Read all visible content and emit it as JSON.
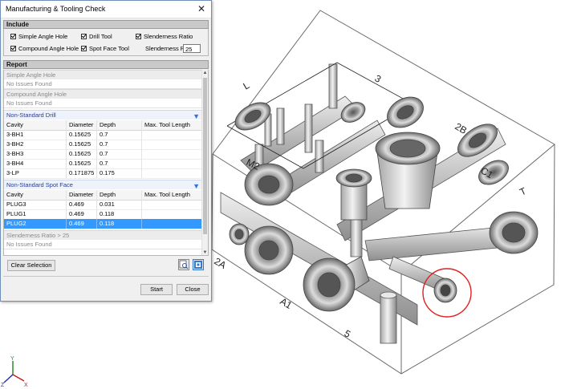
{
  "dialog": {
    "title": "Manufacturing & Tooling Check",
    "close_glyph": "✕"
  },
  "include": {
    "header": "Include",
    "options": {
      "simple_angle_hole": "Simple Angle Hole",
      "drill_tool": "Drill Tool",
      "slenderness_ratio": "Slenderness Ratio",
      "compound_angle_hole": "Compound Angle Hole",
      "spot_face_tool": "Spot Face Tool"
    },
    "slenderness_ratio_label": "Slenderness Ratio",
    "slenderness_ratio_value": "25"
  },
  "report": {
    "header": "Report",
    "simple_angle_hole": {
      "title": "Simple Angle Hole",
      "status": "No Issues Found"
    },
    "compound_angle_hole": {
      "title": "Compound Angle Hole",
      "status": "No Issues Found"
    },
    "non_standard_drill": {
      "title": "Non-Standard Drill",
      "columns": [
        "Cavity",
        "Diameter",
        "Depth",
        "Max. Tool Length"
      ],
      "rows": [
        [
          "3-BH1",
          "0.15625",
          "0.7",
          ""
        ],
        [
          "3-BH2",
          "0.15625",
          "0.7",
          ""
        ],
        [
          "3-BH3",
          "0.15625",
          "0.7",
          ""
        ],
        [
          "3-BH4",
          "0.15625",
          "0.7",
          ""
        ],
        [
          "3-LP",
          "0.171875",
          "0.175",
          ""
        ]
      ]
    },
    "non_standard_spot_face": {
      "title": "Non-Standard Spot Face",
      "columns": [
        "Cavity",
        "Diameter",
        "Depth",
        "Max. Tool Length"
      ],
      "rows": [
        [
          "PLUG3",
          "0.469",
          "0.031",
          ""
        ],
        [
          "PLUG1",
          "0.469",
          "0.118",
          ""
        ],
        [
          "PLUG2",
          "0.469",
          "0.118",
          ""
        ]
      ],
      "selected_row": "PLUG2"
    },
    "slenderness": {
      "title": "Slenderness Ratio > 25",
      "status": "No Issues Found"
    }
  },
  "buttons": {
    "clear_selection": "Clear Selection",
    "start": "Start",
    "close": "Close"
  },
  "model_labels": {
    "port_l": "L",
    "port_3": "3",
    "port_2b": "2B",
    "port_m2": "M2",
    "port_c1": "C1",
    "port_t": "T",
    "port_2a": "2A",
    "port_a1": "A1",
    "port_5": "5"
  },
  "triad": {
    "x": "X",
    "y": "Y",
    "z": "Z"
  },
  "colors": {
    "selection": "#3399ff",
    "highlight_circle": "#e02020",
    "group_header_text": "#2a3d8f"
  }
}
